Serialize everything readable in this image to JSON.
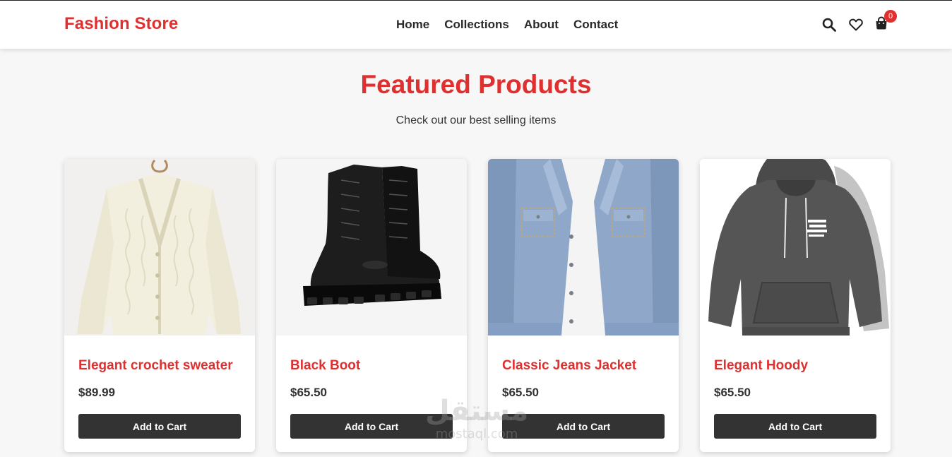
{
  "header": {
    "brand": "Fashion Store",
    "nav": [
      "Home",
      "Collections",
      "About",
      "Contact"
    ],
    "cart_count": "0"
  },
  "hero": {
    "title": "Featured Products",
    "subtitle": "Check out our best selling items"
  },
  "products": [
    {
      "name": "Elegant crochet sweater",
      "price": "$89.99",
      "button": "Add to Cart"
    },
    {
      "name": "Black Boot",
      "price": "$65.50",
      "button": "Add to Cart"
    },
    {
      "name": "Classic Jeans Jacket",
      "price": "$65.50",
      "button": "Add to Cart"
    },
    {
      "name": "Elegant Hoody",
      "price": "$65.50",
      "button": "Add to Cart"
    }
  ],
  "watermark": {
    "arabic": "مستقل",
    "latin": "mostaql.com"
  },
  "colors": {
    "accent": "#e02f2f",
    "button": "#333333",
    "background": "#f7f7f7"
  },
  "icons": [
    "search-icon",
    "heart-icon",
    "cart-icon"
  ]
}
